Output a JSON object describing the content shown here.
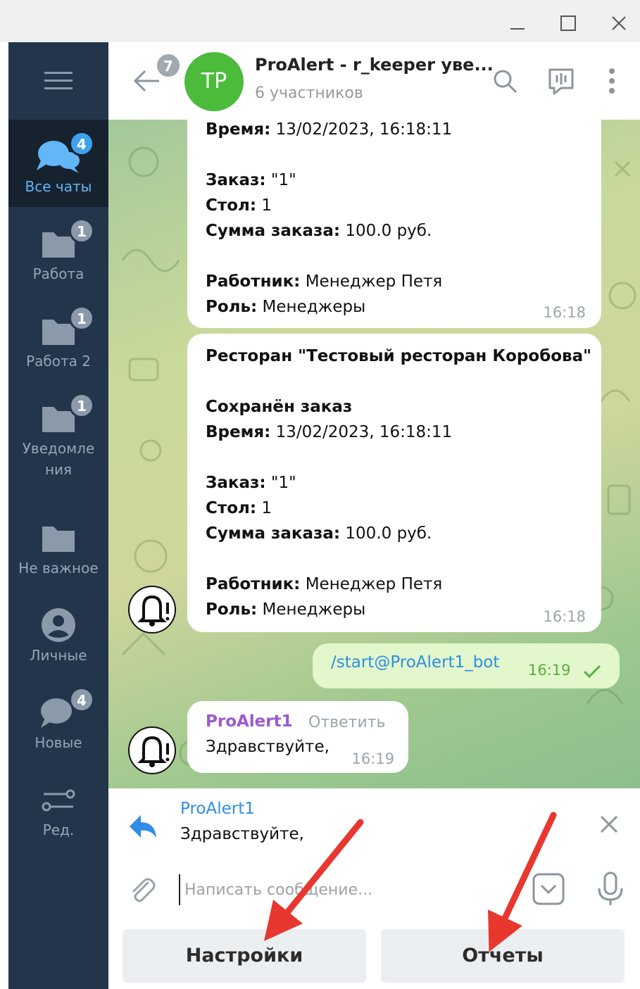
{
  "window": {
    "controls": [
      "minimize",
      "maximize",
      "close"
    ]
  },
  "sidebar": {
    "items": [
      {
        "label": "Все чаты",
        "badge": "4",
        "icon": "chats-icon",
        "active": true
      },
      {
        "label": "Работа",
        "badge": "1",
        "icon": "folder-icon"
      },
      {
        "label": "Работа 2",
        "badge": "1",
        "icon": "folder-icon"
      },
      {
        "label": "Уведомле",
        "label2": "ния",
        "badge": "1",
        "icon": "folder-icon"
      },
      {
        "label": "Не важное",
        "icon": "folder-icon"
      },
      {
        "label": "Личные",
        "icon": "person-icon"
      },
      {
        "label": "Новые",
        "badge": "4",
        "icon": "chat-bubble-icon"
      },
      {
        "label": "Ред.",
        "icon": "sliders-icon"
      }
    ]
  },
  "header": {
    "back_badge": "7",
    "avatar_initials": "TP",
    "title": "ProAlert - r_keeper уве...",
    "subtitle": "6 участников"
  },
  "messages": {
    "m1": {
      "time_label": "Время:",
      "time_value": " 13/02/2023, 16:18:11",
      "order_label": "Заказ:",
      "order_value": " \"1\"",
      "table_label": "Стол:",
      "table_value": " 1",
      "sum_label": "Сумма заказа:",
      "sum_value": " 100.0 руб.",
      "worker_label": "Работник:",
      "worker_value": " Менеджер Петя",
      "role_label": "Роль:",
      "role_value": " Менеджеры",
      "timestamp": "16:18"
    },
    "m2": {
      "restaurant": "Ресторан \"Тестовый ресторан Коробова\"",
      "event": "Сохранён заказ",
      "time_label": "Время:",
      "time_value": " 13/02/2023, 16:18:11",
      "order_label": "Заказ:",
      "order_value": " \"1\"",
      "table_label": "Стол:",
      "table_value": " 1",
      "sum_label": "Сумма заказа:",
      "sum_value": " 100.0 руб.",
      "worker_label": "Работник:",
      "worker_value": " Менеджер Петя",
      "role_label": "Роль:",
      "role_value": " Менеджеры",
      "timestamp": "16:18"
    },
    "out": {
      "text": "/start@ProAlert1_bot",
      "timestamp": "16:19"
    },
    "m3": {
      "sender": "ProAlert1",
      "reply_action": "Ответить",
      "text": "Здравствуйте,",
      "timestamp": "16:19"
    }
  },
  "composer": {
    "reply_name": "ProAlert1",
    "reply_text": "Здравствуйте,",
    "placeholder": "Написать сообщение..."
  },
  "keyboard": {
    "button1": "Настройки",
    "button2": "Отчеты"
  },
  "colors": {
    "sidebar_bg": "#23354a",
    "sidebar_active": "#17222f",
    "accent": "#3fa1ec",
    "avatar": "#4cbb3c",
    "sender_name": "#9b59d0",
    "outgoing_bubble": "#e2f7cb",
    "arrow": "#e8372f"
  }
}
